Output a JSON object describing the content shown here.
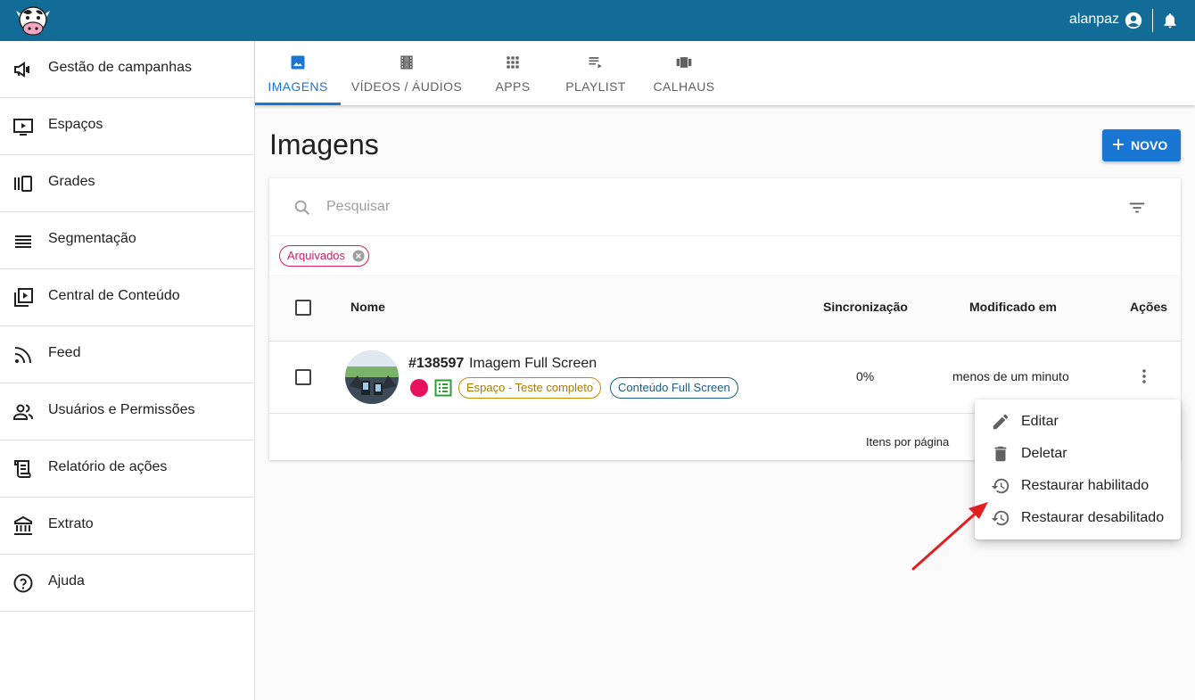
{
  "topbar": {
    "username": "alanpaz",
    "logo_icon": "cow-logo-icon",
    "user_icon": "account-circle-icon",
    "bell_icon": "bell-icon"
  },
  "sidebar": {
    "items": [
      {
        "label": "Gestão de campanhas",
        "icon": "megaphone-icon"
      },
      {
        "label": "Espaços",
        "icon": "tv-play-icon"
      },
      {
        "label": "Grades",
        "icon": "carousel-icon"
      },
      {
        "label": "Segmentação",
        "icon": "lines-icon"
      },
      {
        "label": "Central de Conteúdo",
        "icon": "video-library-icon"
      },
      {
        "label": "Feed",
        "icon": "rss-icon"
      },
      {
        "label": "Usuários e Permissões",
        "icon": "people-icon"
      },
      {
        "label": "Relatório de ações",
        "icon": "scroll-icon"
      },
      {
        "label": "Extrato",
        "icon": "bank-icon"
      },
      {
        "label": "Ajuda",
        "icon": "help-circle-icon"
      }
    ]
  },
  "tabs": [
    {
      "label": "IMAGENS",
      "icon": "image-icon",
      "active": true
    },
    {
      "label": "VÍDEOS / ÁUDIOS",
      "icon": "film-icon",
      "active": false
    },
    {
      "label": "APPS",
      "icon": "apps-grid-icon",
      "active": false
    },
    {
      "label": "PLAYLIST",
      "icon": "playlist-play-icon",
      "active": false
    },
    {
      "label": "CALHAUS",
      "icon": "view-carousel-icon",
      "active": false
    }
  ],
  "page": {
    "title": "Imagens",
    "new_button": "NOVO"
  },
  "search": {
    "placeholder": "Pesquisar",
    "value": ""
  },
  "filter_chip": {
    "label": "Arquivados"
  },
  "table": {
    "columns": [
      "Nome",
      "Sincronização",
      "Modificado em",
      "Ações"
    ],
    "rows": [
      {
        "id": "#138597",
        "name": "Imagem Full Screen",
        "tags": [
          "Espaço - Teste completo",
          "Conteúdo Full Screen"
        ],
        "sync": "0%",
        "modified": "menos de um minuto"
      }
    ]
  },
  "pagination": {
    "items_per_page_label": "Itens por página"
  },
  "actions_menu": {
    "items": [
      {
        "label": "Editar",
        "icon": "pencil-icon"
      },
      {
        "label": "Deletar",
        "icon": "trash-icon"
      },
      {
        "label": "Restaurar habilitado",
        "icon": "history-icon"
      },
      {
        "label": "Restaurar desabilitado",
        "icon": "history-icon"
      }
    ]
  },
  "colors": {
    "topbar": "#136c98",
    "accent": "#1976d2",
    "chip": "#d81b60",
    "status_dot": "#e8115b",
    "annotation_arrow": "#e02020"
  }
}
